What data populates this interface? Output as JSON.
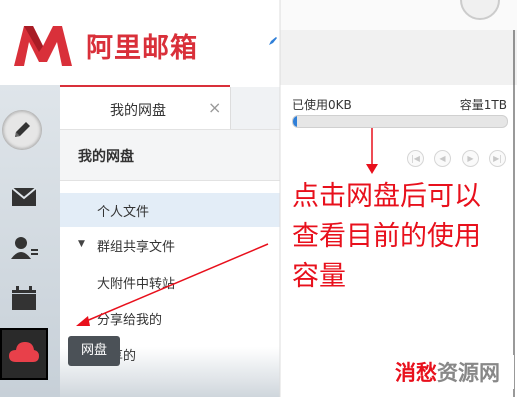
{
  "header": {
    "logo_text": "阿里邮箱"
  },
  "nav": {
    "tab_label": "我的网盘",
    "tab_close": "×",
    "title": "我的网盘",
    "items": [
      {
        "label": "个人文件"
      },
      {
        "label": "群组共享文件"
      },
      {
        "label": "大附件中转站"
      },
      {
        "label": "分享给我的"
      },
      {
        "label": "分享的"
      }
    ],
    "tooltip": "网盘"
  },
  "storage": {
    "used_label": "已使用0KB",
    "capacity_label": "容量1TB",
    "used_fraction": 0.02
  },
  "annotation": {
    "text": "点击网盘后可以查看目前的使用容量"
  },
  "watermark": {
    "part1": "消愁",
    "part2": "资源网"
  },
  "colors": {
    "brand_red": "#d9303a",
    "progress_blue": "#2f7fd8",
    "annotation_red": "#e8101c"
  }
}
